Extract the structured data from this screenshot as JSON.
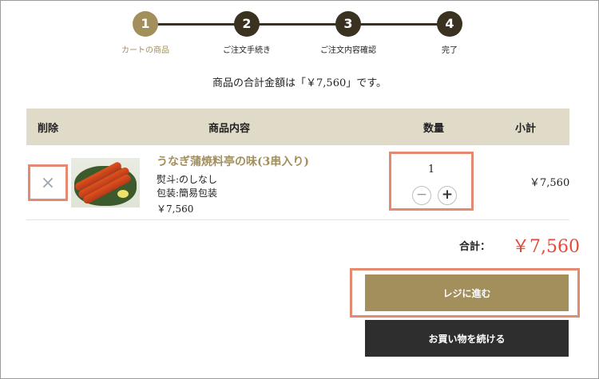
{
  "steps": [
    {
      "num": "1",
      "label": "カートの商品"
    },
    {
      "num": "2",
      "label": "ご注文手続き"
    },
    {
      "num": "3",
      "label": "ご注文内容確認"
    },
    {
      "num": "4",
      "label": "完了"
    }
  ],
  "total_message": "商品の合計金額は「￥7,560」です。",
  "table": {
    "headers": {
      "delete": "削除",
      "content": "商品内容",
      "qty": "数量",
      "subtotal": "小計"
    }
  },
  "item": {
    "remove_icon": "×",
    "title": "うなぎ蒲焼料亭の味(3串入り)",
    "noshi": "熨斗:のしなし",
    "wrapping": "包装:簡易包装",
    "price": "￥7,560",
    "quantity": "1",
    "minus_icon": "−",
    "plus_icon": "+",
    "subtotal": "￥7,560"
  },
  "summary": {
    "label": "合計：",
    "value": "￥7,560"
  },
  "buttons": {
    "checkout": "レジに進む",
    "continue": "お買い物を続ける"
  },
  "colors": {
    "accent": "#a38f5c",
    "dark": "#3a3120",
    "highlight": "#e38a70",
    "price": "#e34a3a",
    "header_bg": "#e0dbc9"
  }
}
